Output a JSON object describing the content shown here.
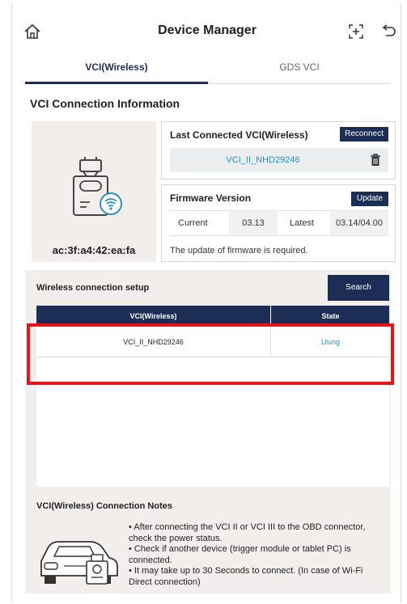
{
  "header": {
    "title": "Device Manager",
    "icons": [
      "home-icon",
      "scan-add-icon",
      "back-icon"
    ]
  },
  "tabs": [
    {
      "label": "VCI(Wireless)",
      "active": true
    },
    {
      "label": "GDS VCI",
      "active": false
    }
  ],
  "connection_info": {
    "section_title": "VCI Connection Information",
    "mac_address": "ac:3f:a4:42:ea:fa",
    "last_connected": {
      "title": "Last Connected VCI(Wireless)",
      "reconnect_label": "Reconnect",
      "vci_name": "VCI_II_NHD29246"
    },
    "firmware": {
      "title": "Firmware Version",
      "update_label": "Update",
      "current_label": "Current",
      "current_value": "03.13",
      "latest_label": "Latest",
      "latest_value": "03.14/04.00",
      "note": "The update of firmware is required."
    }
  },
  "wireless_setup": {
    "title": "Wireless connection setup",
    "search_label": "Search",
    "table": {
      "columns": [
        "VCI(Wireless)",
        "State"
      ],
      "rows": [
        {
          "vci": "VCI_II_NHD29246",
          "state": "Using"
        }
      ]
    }
  },
  "notes": {
    "title": "VCI(Wireless) Connection Notes",
    "items": [
      "• After connecting the VCI II or VCI III to the OBD connector, check the power status.",
      "• Check if another device (trigger module or tablet PC) is connected.",
      "• It may take up to 30 Seconds to connect. (In case of Wi-Fi Direct connection)"
    ]
  },
  "colors": {
    "brand_navy": "#1c2e55",
    "link_blue": "#2a8fbf",
    "highlight_red": "#e8141b",
    "panel_beige": "#f2eeec"
  }
}
